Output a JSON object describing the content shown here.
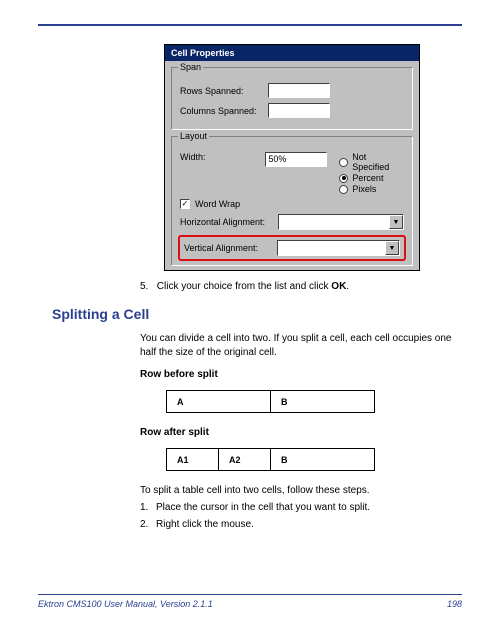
{
  "dialog": {
    "title": "Cell Properties",
    "span": {
      "legend": "Span",
      "rows_label": "Rows Spanned:",
      "rows_value": "",
      "cols_label": "Columns Spanned:",
      "cols_value": ""
    },
    "layout": {
      "legend": "Layout",
      "width_label": "Width:",
      "width_value": "50%",
      "radios": {
        "not_specified": "Not Specified",
        "percent": "Percent",
        "pixels": "Pixels"
      },
      "wordwrap_label": "Word Wrap",
      "halign_label": "Horizontal Alignment:",
      "valign_label": "Vertical Alignment:"
    }
  },
  "step5_prefix": "5.",
  "step5_text_a": "Click your choice from the list and click ",
  "step5_text_b": "OK",
  "step5_text_c": ".",
  "heading": "Splitting a Cell",
  "para1": "You can divide a cell into two. If you split a cell, each cell occupies one half the size of the original cell.",
  "before_label": "Row before split",
  "table_before": {
    "a": "A",
    "b": "B"
  },
  "after_label": "Row after split",
  "table_after": {
    "a1": "A1",
    "a2": "A2",
    "b": "B"
  },
  "steps_intro": "To split a table cell into two cells, follow these steps.",
  "step1_num": "1.",
  "step1": "Place the cursor in the cell that you want to split.",
  "step2_num": "2.",
  "step2": "Right click the mouse.",
  "footer_left": "Ektron CMS100 User Manual, Version 2.1.1",
  "footer_right": "198"
}
